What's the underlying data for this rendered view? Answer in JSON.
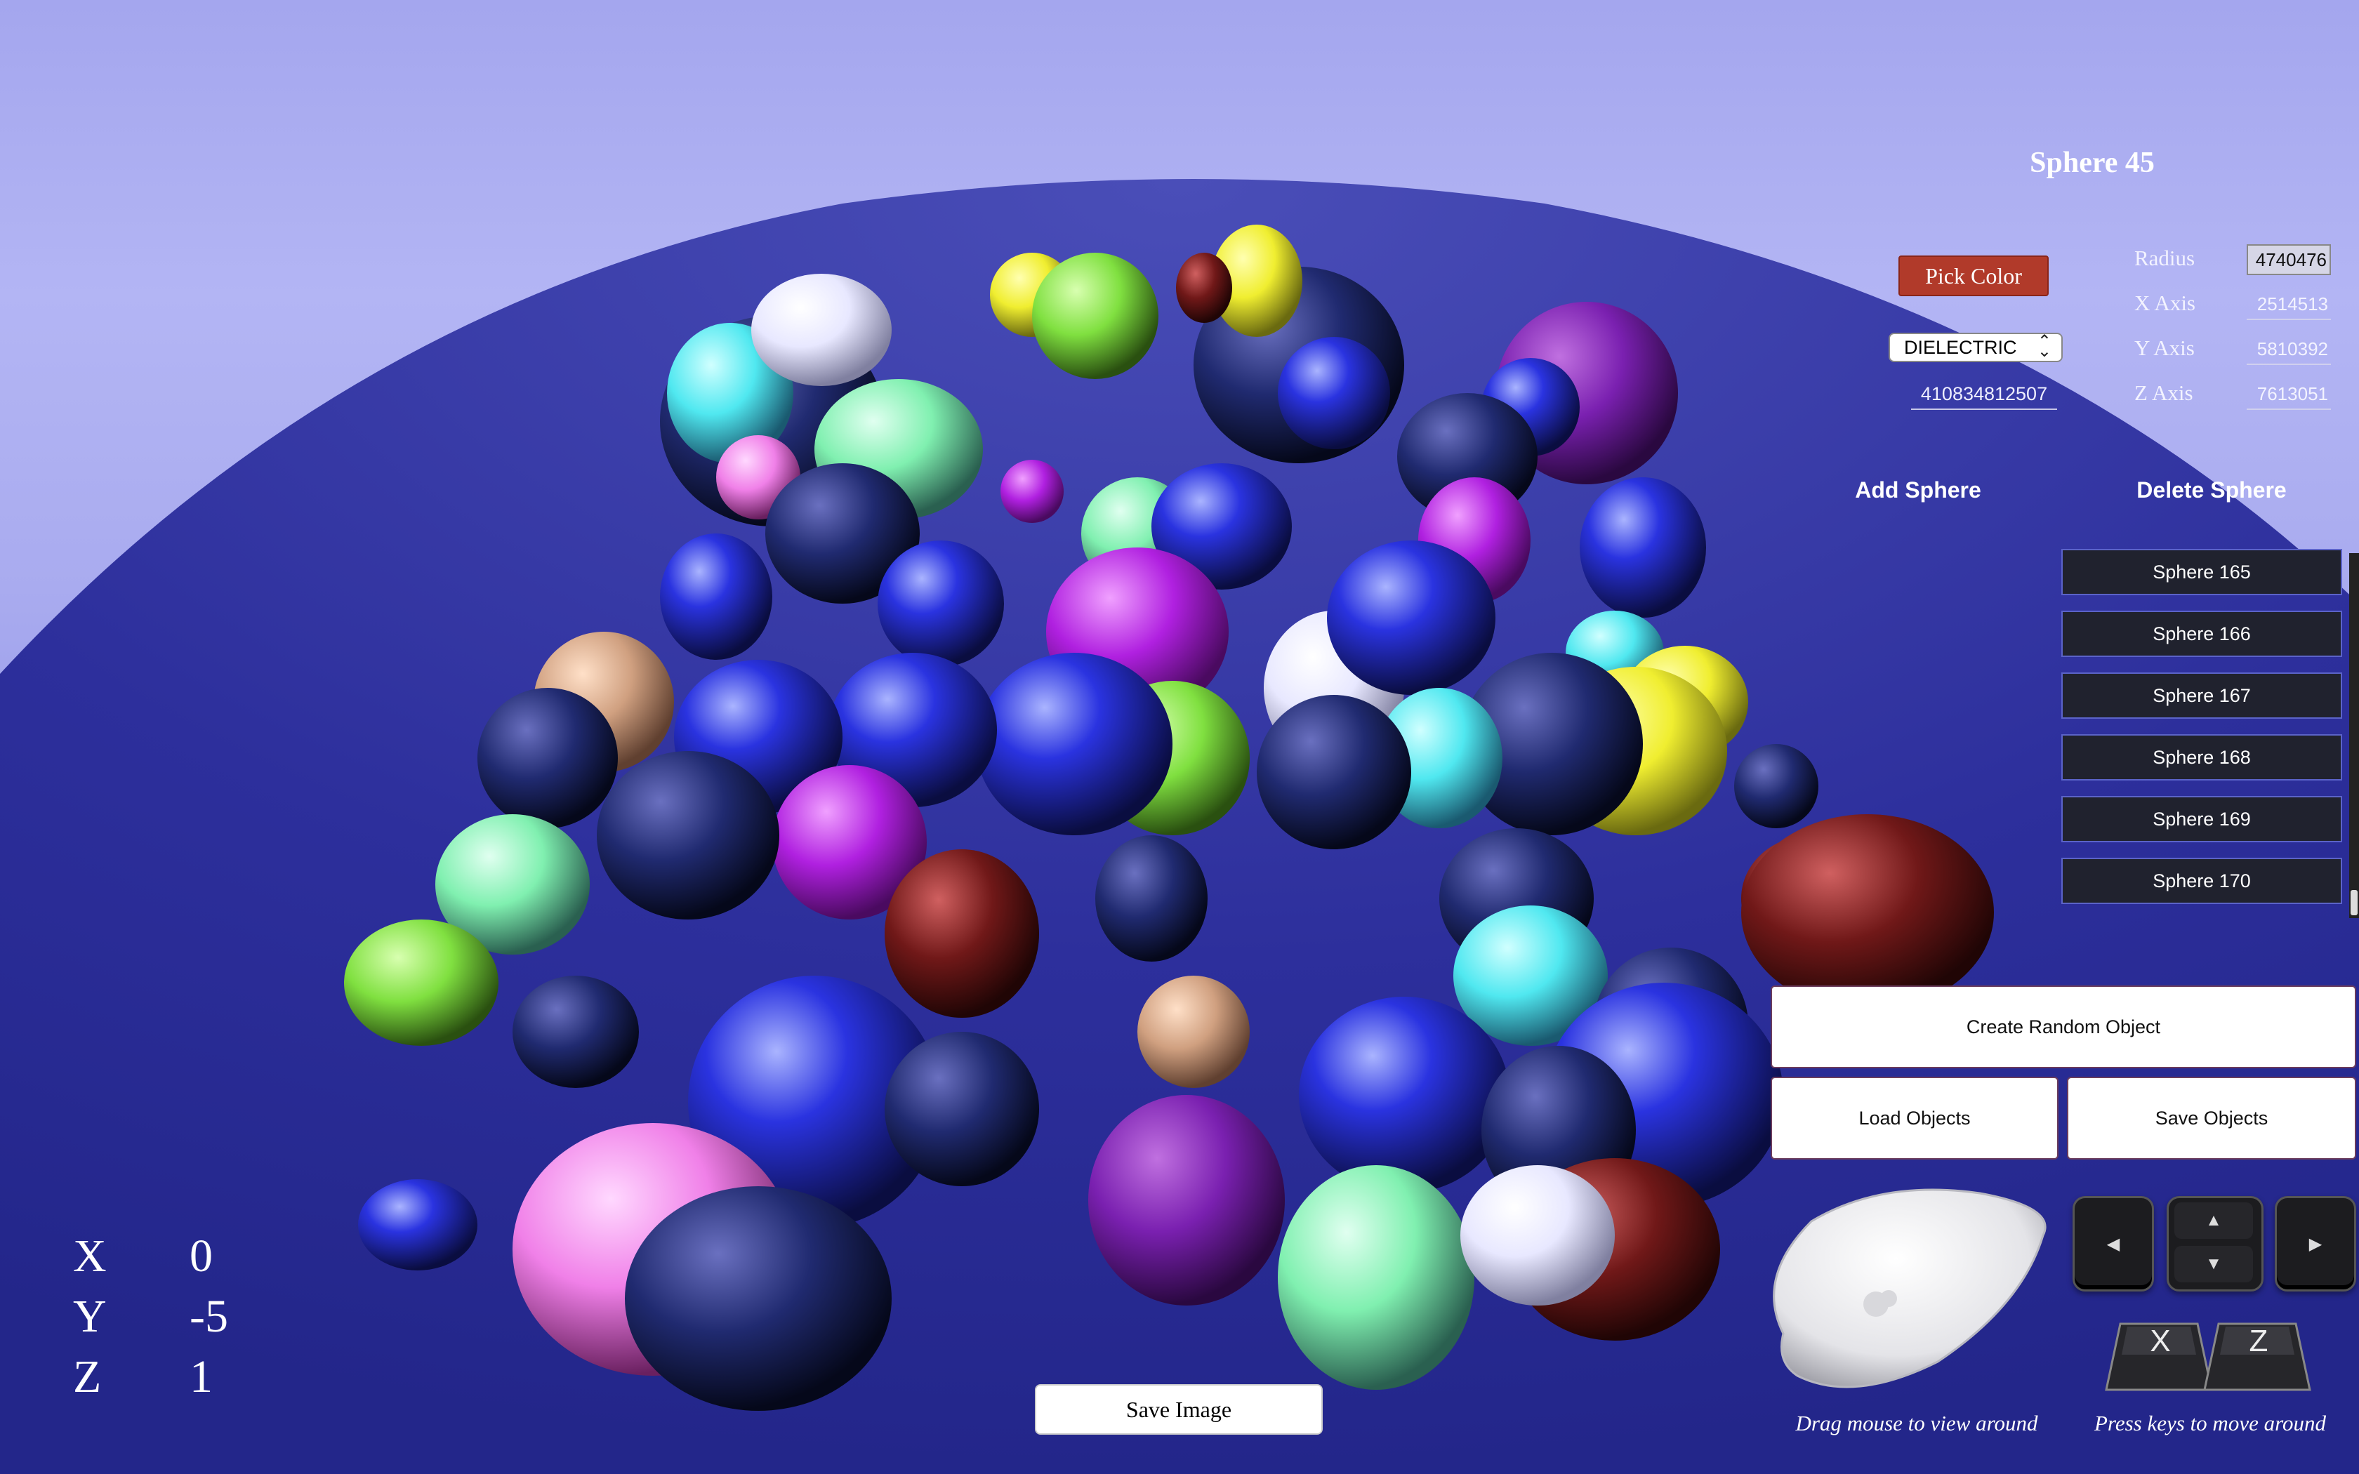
{
  "editor": {
    "title": "Sphere 45",
    "pick_color_label": "Pick Color",
    "material": "DIELECTRIC",
    "fuzz_value": "410834812507",
    "fields": [
      {
        "label": "Radius",
        "value": "4740476"
      },
      {
        "label": "X Axis",
        "value": "2514513"
      },
      {
        "label": "Y Axis",
        "value": "5810392"
      },
      {
        "label": "Z Axis",
        "value": "7613051"
      }
    ],
    "add_label": "Add Sphere",
    "delete_label": "Delete Sphere"
  },
  "sphere_list": [
    "Sphere 165",
    "Sphere 166",
    "Sphere 167",
    "Sphere 168",
    "Sphere 169",
    "Sphere 170"
  ],
  "actions": {
    "create_random": "Create Random Object",
    "load": "Load Objects",
    "save": "Save Objects",
    "save_image": "Save Image"
  },
  "coordinates": [
    {
      "axis": "X",
      "value": "0"
    },
    {
      "axis": "Y",
      "value": "-5"
    },
    {
      "axis": "Z",
      "value": "1"
    }
  ],
  "hints": {
    "mouse": "Drag mouse to view around",
    "keys": "Press keys to move around"
  },
  "keys": {
    "left": "◀",
    "up": "▲",
    "down": "▼",
    "right": "▶",
    "x": "X",
    "z": "Z"
  },
  "colors": {
    "sky": "#a4a6ee",
    "ground": "#2a2d9a",
    "pick_color_button": "#b13a2a",
    "list_item_bg": "#20222e",
    "list_item_border": "#5b63c8"
  }
}
